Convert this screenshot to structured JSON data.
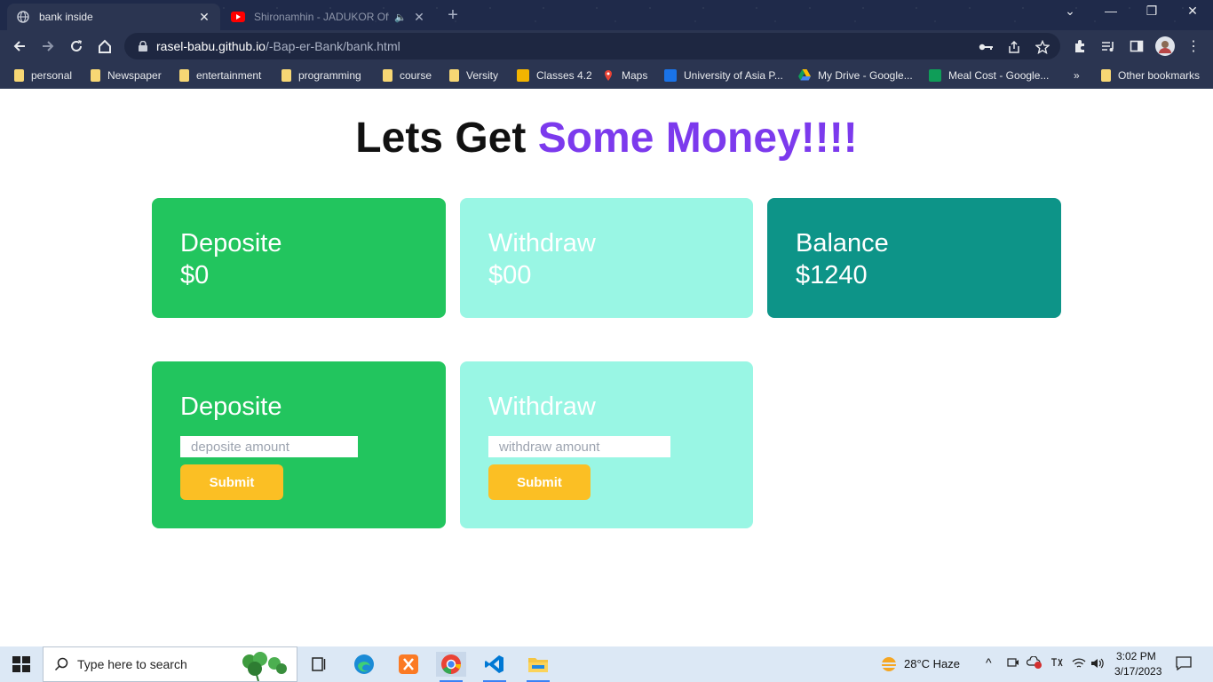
{
  "browser": {
    "active_tab": {
      "title": "bank inside"
    },
    "inactive_tab": {
      "title": "Shironamhin - JADUKOR Offi"
    },
    "url_host": "rasel-babu.github.io",
    "url_path": "/-Bap-er-Bank/bank.html",
    "bookmarks": [
      {
        "label": "personal",
        "icon": "folder-icon"
      },
      {
        "label": "Newspaper",
        "icon": "folder-icon"
      },
      {
        "label": "entertainment",
        "icon": "folder-icon"
      },
      {
        "label": "programming",
        "icon": "folder-icon"
      },
      {
        "label": "course",
        "icon": "folder-icon"
      },
      {
        "label": "Versity",
        "icon": "folder-icon"
      },
      {
        "label": "Classes 4.2",
        "icon": "classroom-icon"
      },
      {
        "label": "Maps",
        "icon": "maps-icon"
      },
      {
        "label": "University of Asia P...",
        "icon": "university-icon"
      },
      {
        "label": "My Drive - Google...",
        "icon": "drive-icon"
      },
      {
        "label": "Meal Cost - Google...",
        "icon": "sheets-icon"
      }
    ],
    "overflow_label": "»",
    "other_bookmarks": "Other bookmarks"
  },
  "page": {
    "title_plain": "Lets Get ",
    "title_accent": "Some Money!!!!",
    "summary": {
      "deposit": {
        "label": "Deposite",
        "value": "$0"
      },
      "withdraw": {
        "label": "Withdraw",
        "value": "$00"
      },
      "balance": {
        "label": "Balance",
        "value": "$1240"
      }
    },
    "deposit_form": {
      "label": "Deposite",
      "placeholder": "deposite amount",
      "submit": "Submit"
    },
    "withdraw_form": {
      "label": "Withdraw",
      "placeholder": "withdraw amount",
      "submit": "Submit"
    }
  },
  "taskbar": {
    "search_placeholder": "Type here to search",
    "weather": "28°C  Haze",
    "time": "3:02 PM",
    "date": "3/17/2023"
  },
  "colors": {
    "accent_purple": "#7c3aed",
    "card_green": "#22c55e",
    "card_mint": "#99f6e4",
    "card_teal": "#0d9488",
    "button_yellow": "#fbbf24"
  }
}
